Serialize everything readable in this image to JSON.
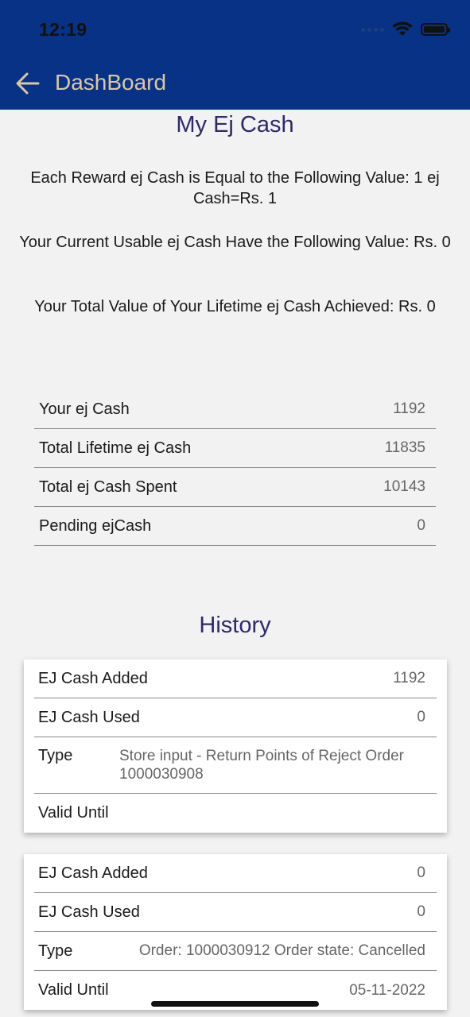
{
  "status": {
    "time": "12:19"
  },
  "nav": {
    "title": "DashBoard",
    "back_icon": "arrow-left-icon"
  },
  "colors": {
    "header_bg": "#073286",
    "title_color": "#2d2a6b",
    "nav_title_color": "#d9c8a5"
  },
  "main": {
    "title": "My Ej Cash",
    "info": [
      "Each Reward ej Cash is Equal to the Following Value: 1 ej Cash=Rs. 1",
      "Your Current Usable ej Cash Have the Following Value: Rs. 0",
      "Your Total Value of Your Lifetime ej Cash Achieved: Rs. 0"
    ]
  },
  "summary": [
    {
      "label": "Your ej Cash",
      "value": "1192"
    },
    {
      "label": "Total Lifetime ej Cash",
      "value": "11835"
    },
    {
      "label": "Total ej Cash Spent",
      "value": "10143"
    },
    {
      "label": "Pending ejCash",
      "value": "0"
    }
  ],
  "history": {
    "title": "History",
    "entries": [
      {
        "added_label": "EJ Cash Added",
        "added_value": "1192",
        "used_label": "EJ Cash Used",
        "used_value": "0",
        "type_label": "Type",
        "type_value": "Store input  - Return Points of Reject Order 1000030908",
        "valid_label": "Valid Until",
        "valid_value": ""
      },
      {
        "added_label": "EJ Cash Added",
        "added_value": "0",
        "used_label": "EJ Cash Used",
        "used_value": "0",
        "type_label": "Type",
        "type_value": "Order: 1000030912  Order state: Cancelled",
        "valid_label": "Valid Until",
        "valid_value": "05-11-2022"
      }
    ]
  }
}
